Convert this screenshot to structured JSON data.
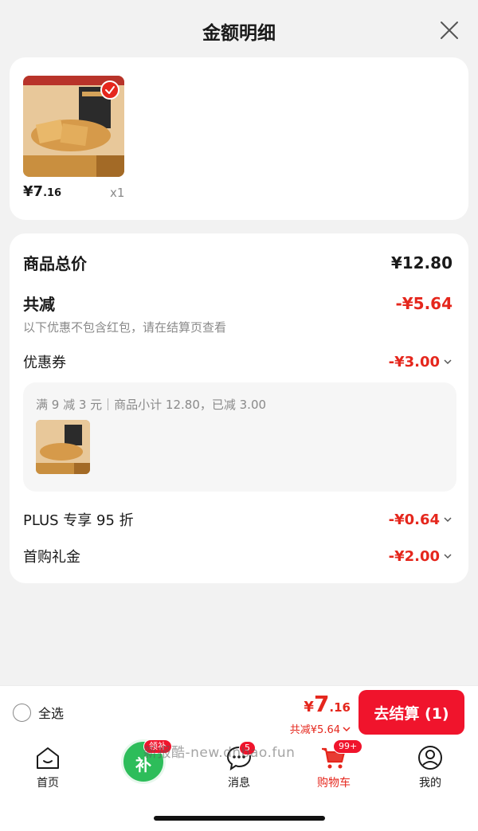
{
  "sheet": {
    "title": "金额明细"
  },
  "product": {
    "price_main": "¥7",
    "price_dec": ".16",
    "qty": "x1"
  },
  "summary": {
    "total_label": "商品总价",
    "total_value": "¥12.80",
    "reduce_label": "共减",
    "reduce_value": "-¥5.64",
    "note": "以下优惠不包含红包，请在结算页查看",
    "coupon_label": "优惠券",
    "coupon_value": "-¥3.00",
    "coupon_detail": "满 9 减 3 元｜商品小计 12.80，已减 3.00",
    "plus_label": "PLUS 专享 95 折",
    "plus_value": "-¥0.64",
    "gift_label": "首购礼金",
    "gift_value": "-¥2.00"
  },
  "bottom_bar": {
    "select_all": "全选",
    "total_cur": "¥",
    "total_main": "7",
    "total_dec": ".16",
    "saved": "共减¥5.64",
    "checkout": "去结算 (1)"
  },
  "tabbar": {
    "home": "首页",
    "messages": "消息",
    "cart": "购物车",
    "me": "我的",
    "subsidy": "补",
    "subsidy_badge": "领补",
    "messages_badge": "5",
    "cart_badge": "99+"
  },
  "watermark": "新报酷-new.dnbao.fun",
  "colors": {
    "accent": "#e5271d",
    "checkout": "#f0142c",
    "subsidy": "#2dbd5a"
  },
  "icons": [
    "close-icon",
    "check-icon",
    "chevron-down-icon",
    "home-icon",
    "message-icon",
    "cart-icon",
    "user-icon"
  ]
}
